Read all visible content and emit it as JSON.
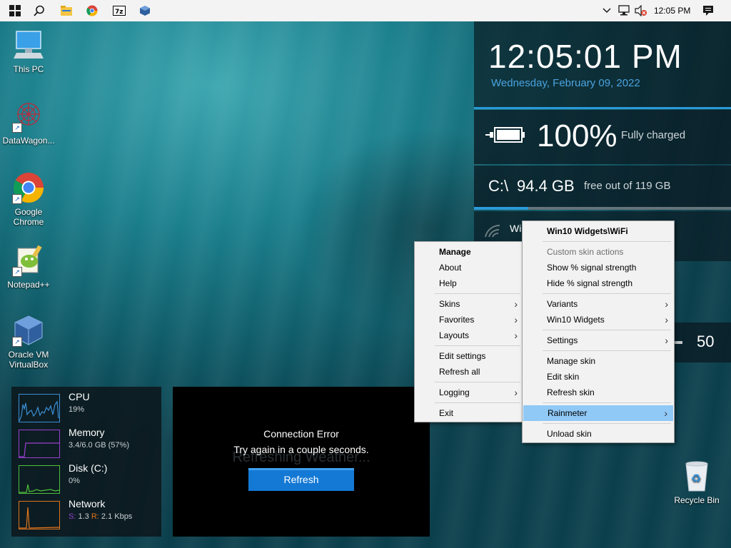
{
  "taskbar": {
    "clock": "12:05 PM",
    "icons": [
      "windows-start-icon",
      "search-icon",
      "file-explorer-icon",
      "chrome-icon",
      "7zip-icon",
      "virtualbox-icon"
    ],
    "tray_icons": [
      "chevron-up-icon",
      "network-icon",
      "volume-muted-icon",
      "notification-icon"
    ]
  },
  "desktop": {
    "icons": [
      {
        "label": "This PC"
      },
      {
        "label": "DataWagon..."
      },
      {
        "label": "Google Chrome"
      },
      {
        "label": "Notepad++"
      },
      {
        "label": "Oracle VM VirtualBox"
      },
      {
        "label": "Recycle Bin"
      }
    ]
  },
  "widgets": {
    "clock": {
      "time": "12:05:01 PM",
      "date": "Wednesday, February 09, 2022",
      "accent": "#4aa3e0"
    },
    "battery": {
      "percent": "100%",
      "status": "Fully charged"
    },
    "disk": {
      "drive": "C:\\",
      "free": "94.4 GB",
      "of": "free out of 119 GB",
      "used_fraction": 0.21
    },
    "wifi": {
      "label_partial": "Wi"
    },
    "volume": {
      "value": "50"
    },
    "sysmon": {
      "cpu": {
        "title": "CPU",
        "value": "19%",
        "color": "#3a8fd6"
      },
      "memory": {
        "title": "Memory",
        "value": "3.4/6.0 GB (57%)",
        "color": "#9b3fd0"
      },
      "disk": {
        "title": "Disk (C:)",
        "value": "0%",
        "color": "#4fbf3a"
      },
      "network": {
        "title": "Network",
        "s_label": "S:",
        "s_value": "1.3",
        "r_label": "R:",
        "r_value": "2.1 Kbps",
        "color": "#e0751b"
      }
    },
    "weather": {
      "ghost": "Refreshing Weather...",
      "error_title": "Connection Error",
      "error_msg": "Try again in a couple seconds.",
      "button": "Refresh"
    }
  },
  "menu_left": {
    "items": [
      {
        "label": "Manage"
      },
      {
        "label": "About"
      },
      {
        "label": "Help"
      },
      {
        "label": "Skins"
      },
      {
        "label": "Favorites"
      },
      {
        "label": "Layouts"
      },
      {
        "label": "Edit settings"
      },
      {
        "label": "Refresh all"
      },
      {
        "label": "Logging"
      },
      {
        "label": "Exit"
      }
    ]
  },
  "menu_right": {
    "items": [
      {
        "label": "Win10 Widgets\\WiFi"
      },
      {
        "label": "Custom skin actions"
      },
      {
        "label": "Show % signal strength"
      },
      {
        "label": "Hide % signal strength"
      },
      {
        "label": "Variants"
      },
      {
        "label": "Win10 Widgets"
      },
      {
        "label": "Settings"
      },
      {
        "label": "Manage skin"
      },
      {
        "label": "Edit skin"
      },
      {
        "label": "Refresh skin"
      },
      {
        "label": "Rainmeter"
      },
      {
        "label": "Unload skin"
      }
    ]
  }
}
